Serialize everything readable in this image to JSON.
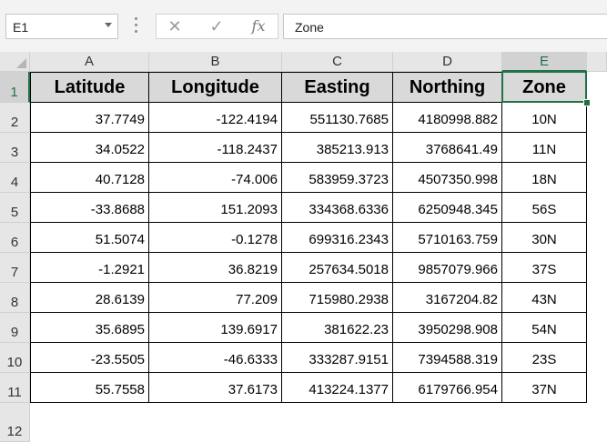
{
  "name_box": {
    "value": "E1"
  },
  "formula_bar": {
    "value": "Zone",
    "cancel_icon": "close-icon",
    "enter_icon": "check-icon",
    "function_label": "fx"
  },
  "columns": [
    "A",
    "B",
    "C",
    "D",
    "E"
  ],
  "rows": [
    "1",
    "2",
    "3",
    "4",
    "5",
    "6",
    "7",
    "8",
    "9",
    "10",
    "11",
    "12"
  ],
  "selected": {
    "column": "E",
    "row": "1"
  },
  "accent_color": "#217346",
  "table": {
    "headers": [
      "Latitude",
      "Longitude",
      "Easting",
      "Northing",
      "Zone"
    ],
    "rows": [
      [
        "37.7749",
        "-122.4194",
        "551130.7685",
        "4180998.882",
        "10N"
      ],
      [
        "34.0522",
        "-118.2437",
        "385213.913",
        "3768641.49",
        "11N"
      ],
      [
        "40.7128",
        "-74.006",
        "583959.3723",
        "4507350.998",
        "18N"
      ],
      [
        "-33.8688",
        "151.2093",
        "334368.6336",
        "6250948.345",
        "56S"
      ],
      [
        "51.5074",
        "-0.1278",
        "699316.2343",
        "5710163.759",
        "30N"
      ],
      [
        "-1.2921",
        "36.8219",
        "257634.5018",
        "9857079.966",
        "37S"
      ],
      [
        "28.6139",
        "77.209",
        "715980.2938",
        "3167204.82",
        "43N"
      ],
      [
        "35.6895",
        "139.6917",
        "381622.23",
        "3950298.908",
        "54N"
      ],
      [
        "-23.5505",
        "-46.6333",
        "333287.9151",
        "7394588.319",
        "23S"
      ],
      [
        "55.7558",
        "37.6173",
        "413224.1377",
        "6179766.954",
        "37N"
      ]
    ]
  }
}
